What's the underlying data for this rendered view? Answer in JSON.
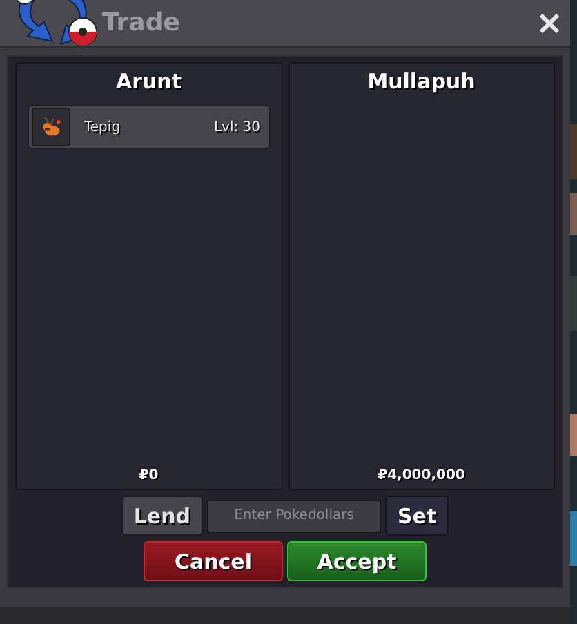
{
  "window": {
    "title": "Trade"
  },
  "traders": [
    {
      "name": "Arunt",
      "items": [
        {
          "name": "Tepig",
          "level_text": "Lvl: 30"
        }
      ],
      "money": "₽0"
    },
    {
      "name": "Mullapuh",
      "money": "₽4,000,000"
    }
  ],
  "money_controls": {
    "lend_button": "Lend",
    "field": {
      "placeholder": "Enter Pokedollars"
    },
    "set_button": "Set"
  },
  "actions": [
    {
      "label": "Cancel",
      "kind": "cancel"
    },
    {
      "label": "Accept",
      "kind": "accept"
    }
  ]
}
